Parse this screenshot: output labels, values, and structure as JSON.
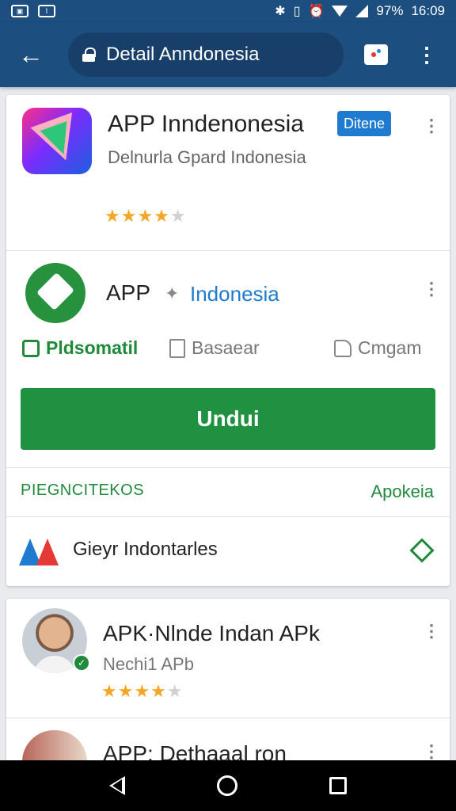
{
  "status_bar": {
    "battery": "97%",
    "time": "16:09",
    "icons": [
      "photo-icon",
      "image-icon",
      "bluetooth-icon",
      "vibrate-icon",
      "alarm-icon",
      "wifi-icon",
      "signal-icon"
    ]
  },
  "toolbar": {
    "back_icon": "arrow-back-icon",
    "url_text": "Detail Anndonesia",
    "tabs_icon": "tabs-icon",
    "menu_icon": "more-vert-icon"
  },
  "card1": {
    "app_title": "APP Inndenonesia",
    "badge": "Ditene",
    "subtitle": "Delnurla Gpard Indonesia",
    "rating_stars": 4,
    "app2_name": "APP",
    "app2_separator": "✦",
    "app2_tag": "Indonesia",
    "actions": [
      {
        "icon": "camera-icon",
        "label": "Pldsomatil"
      },
      {
        "icon": "book-icon",
        "label": "Basaear"
      },
      {
        "icon": "thumb-up-icon",
        "label": "Cmgam"
      }
    ],
    "download_button": "Undui",
    "section_header": "PIEGNCITEKOS",
    "section_link": "Apokeia",
    "row_link_text": "Gieyr Indontarles"
  },
  "card2": {
    "item1_title": "APK·Nlnde Indan APk",
    "item1_sub": "Nechi1 APb",
    "item1_rating": 4,
    "item2_title": "APP: Dethaaal ron"
  },
  "colors": {
    "primary": "#1c4e80",
    "accent_green": "#1f9140",
    "badge_blue": "#1e7bd0",
    "star": "#f5a623"
  }
}
